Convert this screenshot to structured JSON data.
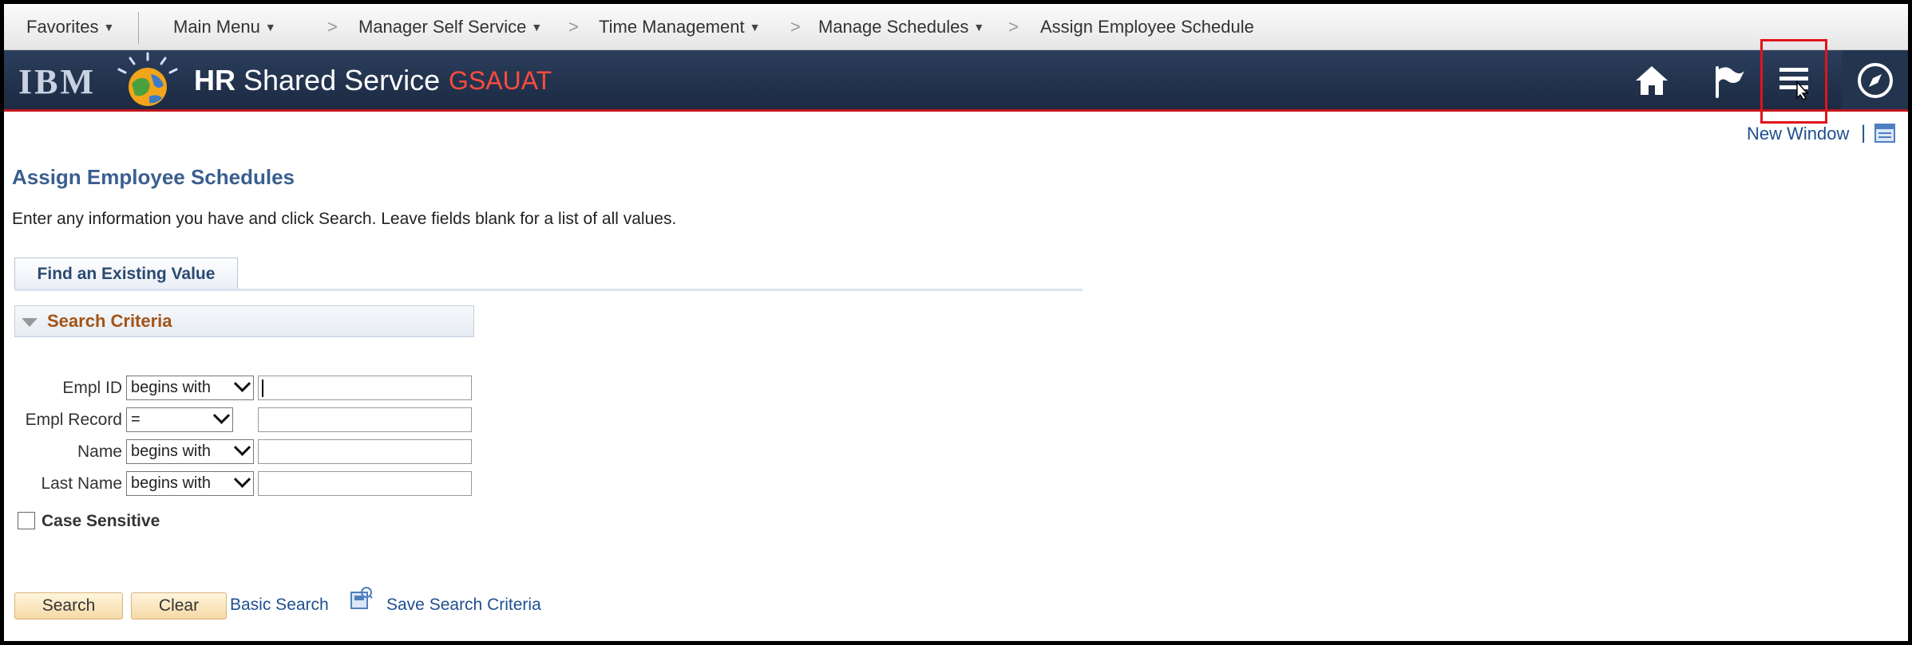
{
  "breadcrumb": {
    "favorites": "Favorites",
    "main_menu": "Main Menu",
    "manager_self_service": "Manager Self Service",
    "time_management": "Time Management",
    "manage_schedules": "Manage Schedules",
    "current": "Assign Employee Schedule",
    "separator": ">"
  },
  "banner": {
    "brand": "IBM",
    "title_bold": "HR",
    "title_rest": " Shared Service",
    "environment": "GSAUAT",
    "icons": [
      "home-icon",
      "flag-icon",
      "navbar-menu-icon",
      "compass-icon"
    ],
    "highlight_color": "#e0141c",
    "accent_color": "#c0141c"
  },
  "header_links": {
    "new_window": "New Window",
    "separator": "|"
  },
  "page": {
    "title": "Assign Employee Schedules",
    "instructions": "Enter any information you have and click Search. Leave fields blank for a list of all values.",
    "tab_label": "Find an Existing Value",
    "section_title": "Search Criteria"
  },
  "criteria": [
    {
      "label": "Empl ID",
      "operator": "begins with",
      "value": ""
    },
    {
      "label": "Empl Record",
      "operator": "=",
      "value": ""
    },
    {
      "label": "Name",
      "operator": "begins with",
      "value": ""
    },
    {
      "label": "Last Name",
      "operator": "begins with",
      "value": ""
    }
  ],
  "case_sensitive": {
    "label": "Case Sensitive",
    "checked": false
  },
  "actions": {
    "search": "Search",
    "clear": "Clear",
    "basic_search": "Basic Search",
    "save_search_criteria": "Save Search Criteria"
  }
}
